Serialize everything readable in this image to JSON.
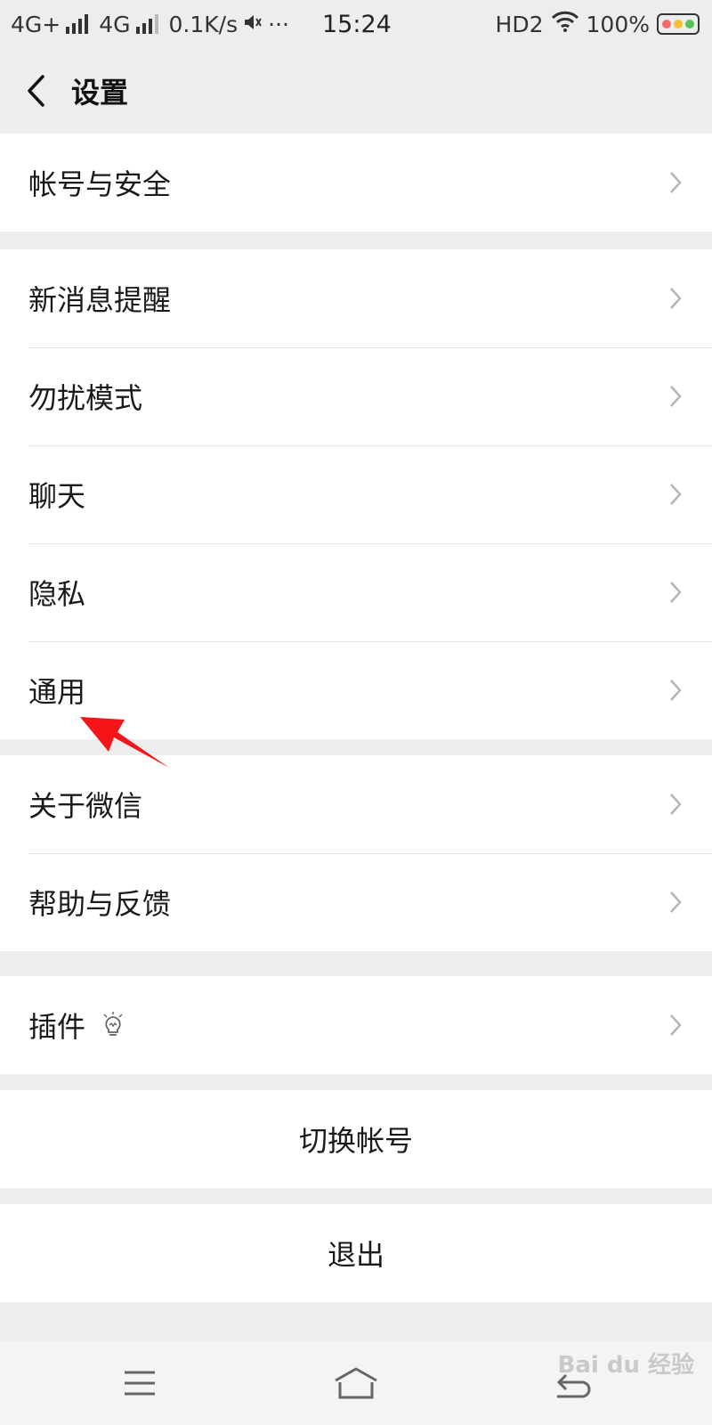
{
  "status_bar": {
    "network1": "4G+",
    "network2": "4G",
    "speed": "0.1K/s",
    "more": "···",
    "time": "15:24",
    "hd": "HD2",
    "battery_pct": "100%"
  },
  "header": {
    "title": "设置"
  },
  "menu": {
    "account_security": "帐号与安全",
    "new_message": "新消息提醒",
    "do_not_disturb": "勿扰模式",
    "chat": "聊天",
    "privacy": "隐私",
    "general": "通用",
    "about": "关于微信",
    "help": "帮助与反馈",
    "plugins": "插件"
  },
  "actions": {
    "switch_account": "切换帐号",
    "logout": "退出"
  },
  "watermark": "Bai du 经验",
  "colors": {
    "background": "#ededed",
    "row": "#ffffff",
    "annotation_arrow": "#f5141a"
  }
}
